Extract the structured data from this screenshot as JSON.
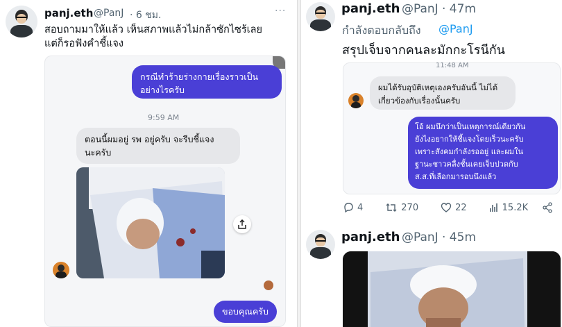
{
  "left": {
    "author_name": "panj.eth",
    "author_handle": "@PanJ",
    "time": "· 6 ชม.",
    "more": "···",
    "text_line1": "สอบถามมาให้แล้ว เห็นสภาพแล้วไม่กล้าซักไซร้เลย",
    "text_line2": "แต่ก็รอฟังคำชี้แจง",
    "chat": {
      "out_1_line1": "กรณีทำร้ายร่างกายเรื่องราวเป็น",
      "out_1_line2": "อย่างไรครับ",
      "timestamp": "9:59 AM",
      "in_1_line1": "ตอนนี้ผมอยู่ รพ อยู่ครับ จะรีบชี้แจง",
      "in_1_line2": "นะครับ",
      "out_2": "ขอบคุณครับ"
    }
  },
  "right": {
    "tweet1": {
      "author_name": "panj.eth",
      "author_handle": "@PanJ",
      "time": "· 47m",
      "reply_prefix": "กำลังตอบกลับถึง",
      "reply_handle": "@PanJ",
      "text": "สรุปเจ็บจากคนละมักกะโรนีกัน",
      "chat": {
        "timestamp": "11:48 AM",
        "in_1_line1": "ผมได้รับอุบัติเหตุเองครับอันนี้ ไม่ได้",
        "in_1_line2": "เกี่ยวข้องกับเรื่องนั้นครับ",
        "out_lines": [
          "โอ้ ผมนึกว่าเป็นเหตุการณ์เดียวกัน",
          "ยังไงอยากให้ชี้แจงโดยเร็วนะครับ",
          "เพราะสังคมกำลังรออยู่ และผมใน",
          "ฐานะชาวคลื่งชั้นเคยเจ็บปวดกับ",
          "ส.ส.ที่เลือกมารอบนึงแล้ว"
        ]
      },
      "stats": {
        "replies": "4",
        "retweets": "270",
        "likes": "22",
        "views": "15.2K"
      }
    },
    "tweet2": {
      "author_name": "panj.eth",
      "author_handle": "@PanJ",
      "time": "· 45m"
    }
  },
  "colors": {
    "accent": "#1d9bf0",
    "bubble_out": "#4a3fd6",
    "bubble_in": "#e6e7ea",
    "muted": "#536471"
  },
  "icons": [
    "reply-icon",
    "retweet-icon",
    "like-icon",
    "views-icon",
    "share-icon",
    "upload-icon",
    "more-icon"
  ]
}
